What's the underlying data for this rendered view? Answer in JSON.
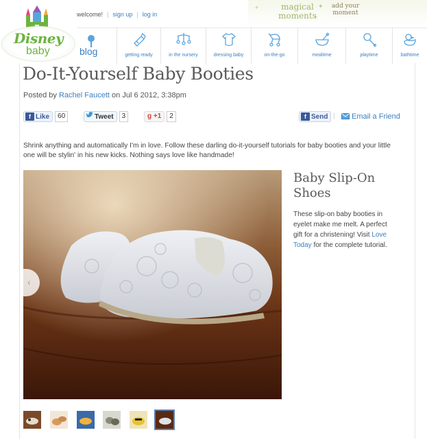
{
  "header": {
    "logo_text": "Disney",
    "logo_sub": "baby",
    "welcome": "welcome!",
    "sign_up": "sign up",
    "log_in": "log in",
    "magical_moments": "magical moments",
    "add_your_moment": "add your moment"
  },
  "nav": {
    "blog": "blog",
    "items": [
      {
        "label": "getting ready",
        "icon": "bottle-icon"
      },
      {
        "label": "in the nursery",
        "icon": "mobile-icon"
      },
      {
        "label": "dressing baby",
        "icon": "onesie-icon"
      },
      {
        "label": "on-the-go",
        "icon": "stroller-icon"
      },
      {
        "label": "mealtime",
        "icon": "bowl-icon"
      },
      {
        "label": "playtime",
        "icon": "rattle-icon"
      },
      {
        "label": "bathtime",
        "icon": "duck-icon"
      }
    ]
  },
  "article": {
    "title": "Do-It-Yourself Baby Booties",
    "posted_by": "Posted by",
    "author": "Rachel Faucett",
    "date": "on Jul 6 2012, 3:38pm",
    "intro": "Shrink anything and automatically I'm in love. Follow these darling do-it-yourself tutorials for baby booties and your little one will be stylin' in his new kicks. Nothing says love like handmade!"
  },
  "social": {
    "like_label": "Like",
    "like_count": "60",
    "tweet_label": "Tweet",
    "tweet_count": "3",
    "gplus_label": "+1",
    "gplus_count": "2",
    "send_label": "Send",
    "email_label": "Email a Friend"
  },
  "slide": {
    "title": "Baby Slip-On Shoes",
    "text_before": "These slip-on baby booties in eyelet make me melt. A perfect gift for a christening! Visit ",
    "link": "Love Today",
    "text_after": " for the complete tutorial."
  },
  "thumbnails": {
    "count": 6,
    "active_index": 5
  },
  "colors": {
    "link": "#3a80c2",
    "logo_green": "#6cb33f",
    "facebook": "#3b5998"
  }
}
